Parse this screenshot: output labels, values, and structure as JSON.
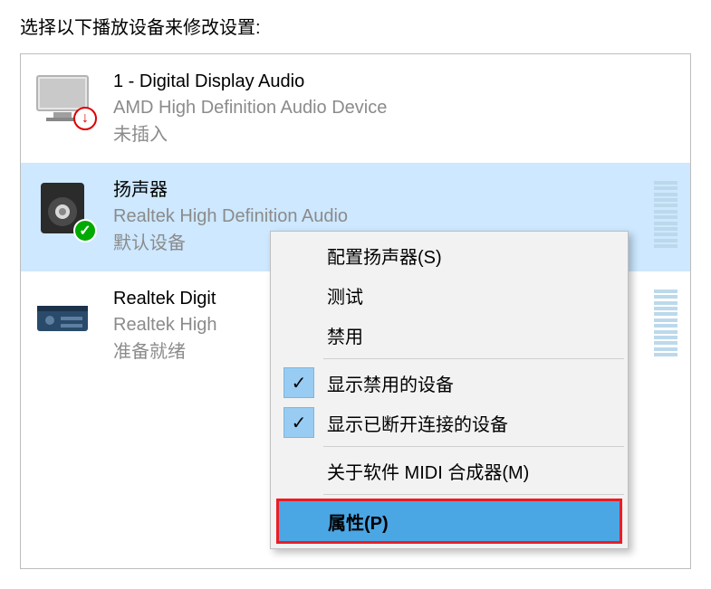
{
  "header": "选择以下播放设备来修改设置:",
  "devices": [
    {
      "title": "1 - Digital Display Audio",
      "subtitle": "AMD High Definition Audio Device",
      "status": "未插入"
    },
    {
      "title": "扬声器",
      "subtitle": "Realtek High Definition Audio",
      "status": "默认设备"
    },
    {
      "title": "Realtek Digit",
      "subtitle": "Realtek High",
      "status": "准备就绪"
    }
  ],
  "context_menu": {
    "configure": "配置扬声器(S)",
    "test": "测试",
    "disable": "禁用",
    "show_disabled": "显示禁用的设备",
    "show_disconnected": "显示已断开连接的设备",
    "about_midi": "关于软件 MIDI 合成器(M)",
    "properties": "属性(P)"
  }
}
